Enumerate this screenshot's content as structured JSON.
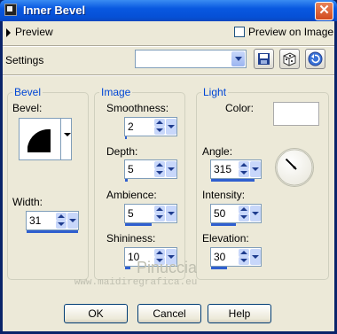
{
  "window": {
    "title": "Inner Bevel",
    "close_glyph": "✕"
  },
  "preview": {
    "label": "Preview",
    "preview_on_image_label": "Preview on Image",
    "preview_on_image_checked": false
  },
  "settings": {
    "label": "Settings",
    "preset_value": ""
  },
  "toolbar": {
    "icons": [
      "save-icon",
      "randomize-icon",
      "reset-icon"
    ]
  },
  "bevel_group": {
    "title": "Bevel",
    "bevel_label": "Bevel:",
    "width_label": "Width:",
    "width_value": "31",
    "width_fraction": 1.0
  },
  "image_group": {
    "title": "Image",
    "smoothness_label": "Smoothness:",
    "smoothness_value": "2",
    "smoothness_fraction": 0.02,
    "depth_label": "Depth:",
    "depth_value": "5",
    "depth_fraction": 0.05,
    "ambience_label": "Ambience:",
    "ambience_value": "5",
    "ambience_fraction": 0.52,
    "shininess_label": "Shininess:",
    "shininess_value": "10",
    "shininess_fraction": 0.1
  },
  "light_group": {
    "title": "Light",
    "color_label": "Color:",
    "color_value": "#ffffff",
    "angle_label": "Angle:",
    "angle_value": "315",
    "angle_fraction": 0.875,
    "intensity_label": "Intensity:",
    "intensity_value": "50",
    "intensity_fraction": 0.5,
    "elevation_label": "Elevation:",
    "elevation_value": "30",
    "elevation_fraction": 0.33
  },
  "buttons": {
    "ok": "OK",
    "cancel": "Cancel",
    "help": "Help"
  },
  "watermark": {
    "line1": "Pinuccia",
    "line2": "www.maidiregrafica.eu"
  },
  "colors": {
    "accent": "#2f5fcf",
    "group_title": "#0046d5",
    "background": "#ece9d8"
  }
}
